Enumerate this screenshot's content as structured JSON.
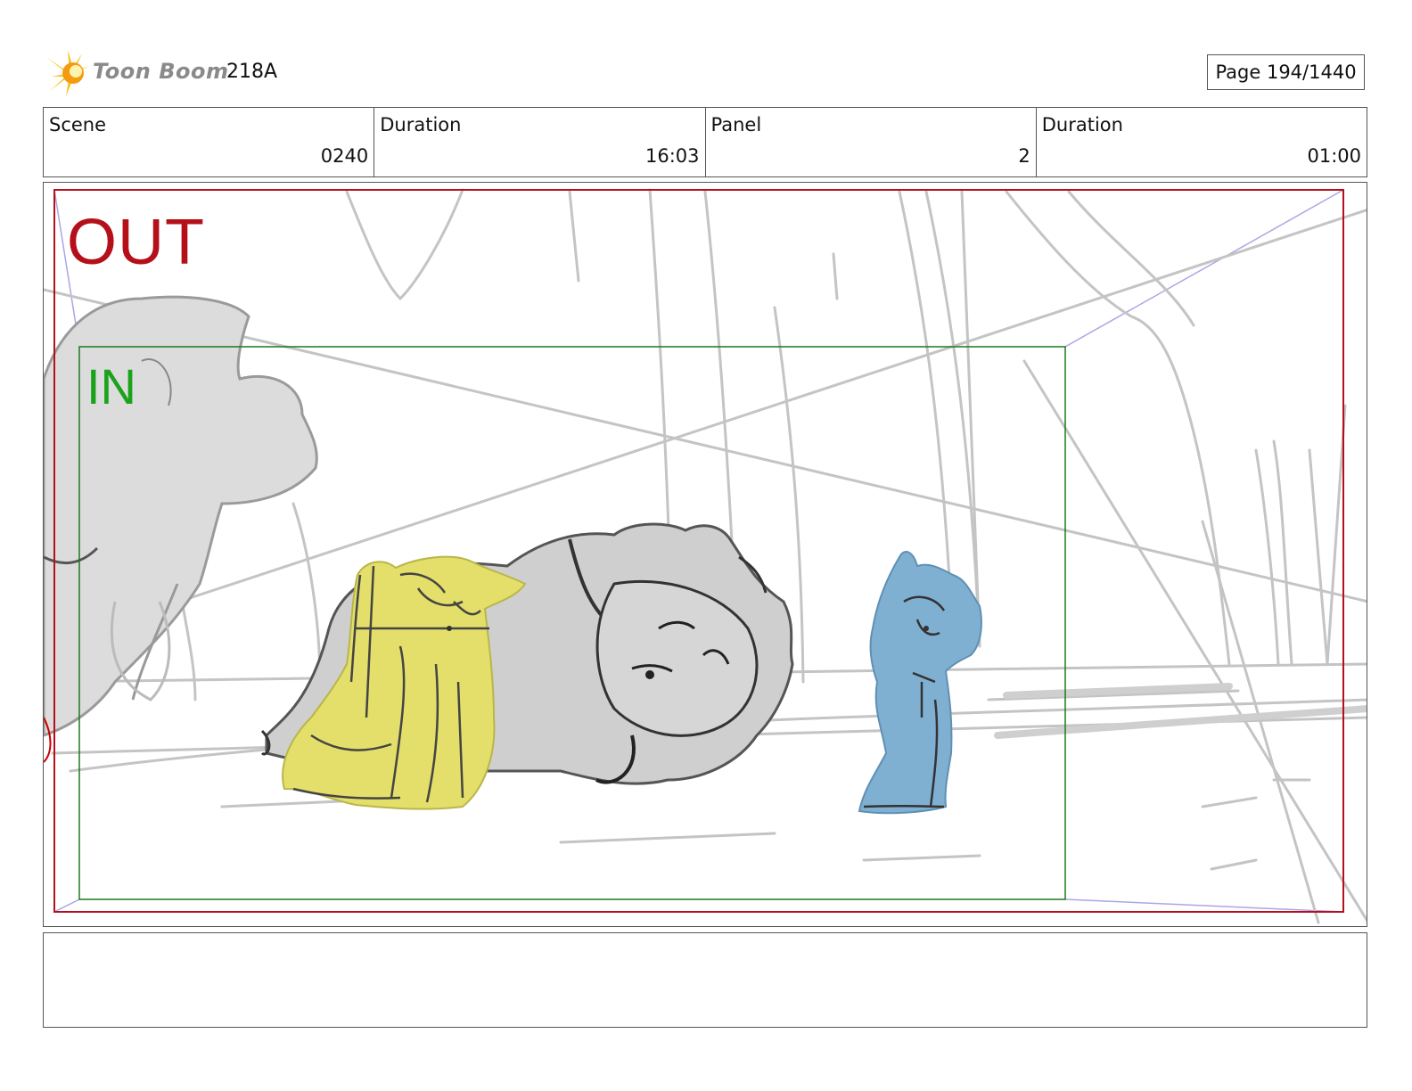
{
  "header": {
    "logo_text": "Toon Boom",
    "episode": "218A",
    "page": "Page  194/1440"
  },
  "info": {
    "scene_label": "Scene",
    "scene_value": "0240",
    "scene_duration_label": "Duration",
    "scene_duration_value": "16:03",
    "panel_label": "Panel",
    "panel_value": "2",
    "panel_duration_label": "Duration",
    "panel_duration_value": "01:00"
  },
  "frame": {
    "out_label": "OUT",
    "in_label": "IN"
  },
  "colors": {
    "out_frame": "#b5101a",
    "in_frame": "#1a7a1a",
    "yellow_character": "#e3df6a",
    "blue_character": "#7fb0d2",
    "sketch_gray": "#c9c9c9"
  },
  "notes": {
    "text": ""
  }
}
